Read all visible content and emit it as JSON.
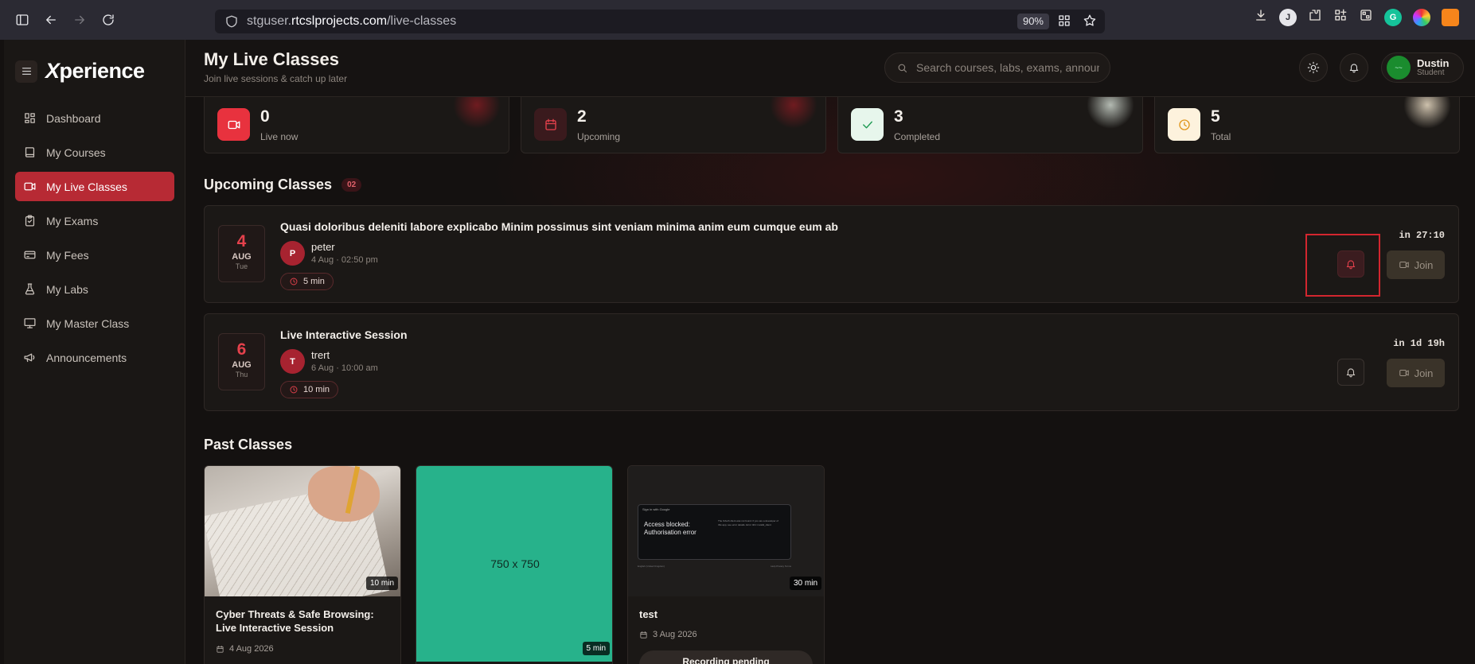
{
  "browser": {
    "url_host": "stguser.",
    "url_domain": "rtcslprojects.com",
    "url_path": "/live-classes",
    "zoom": "90%",
    "ext_j_label": "J"
  },
  "sidebar": {
    "logo_x": "X",
    "logo_rest": "perience",
    "items": [
      {
        "label": "Dashboard",
        "icon": "dashboard-icon"
      },
      {
        "label": "My Courses",
        "icon": "book-icon"
      },
      {
        "label": "My Live Classes",
        "icon": "video-icon"
      },
      {
        "label": "My Exams",
        "icon": "clipboard-icon"
      },
      {
        "label": "My Fees",
        "icon": "card-icon"
      },
      {
        "label": "My Labs",
        "icon": "flask-icon"
      },
      {
        "label": "My Master Class",
        "icon": "presentation-icon"
      },
      {
        "label": "Announcements",
        "icon": "megaphone-icon"
      }
    ],
    "active_index": 2
  },
  "header": {
    "title": "My Live Classes",
    "subtitle": "Join live sessions & catch up later",
    "search_placeholder": "Search courses, labs, exams, announcements...",
    "user_name": "Dustin",
    "user_role": "Student",
    "avatar_text": "~~"
  },
  "stats": [
    {
      "value": "0",
      "label": "Live now",
      "color": "#e8323e"
    },
    {
      "value": "2",
      "label": "Upcoming",
      "color": "#c93a45"
    },
    {
      "value": "3",
      "label": "Completed",
      "color": "#1e9a52"
    },
    {
      "value": "5",
      "label": "Total",
      "color": "#e0961b"
    }
  ],
  "upcoming": {
    "title": "Upcoming Classes",
    "badge": "02",
    "classes": [
      {
        "day": "4",
        "month": "AUG",
        "weekday": "Tue",
        "title": "Quasi doloribus deleniti labore explicabo Minim possimus sint veniam minima anim eum cumque eum ab",
        "instructor_initial": "P",
        "instructor": "peter",
        "when": "4 Aug · 02:50 pm",
        "duration": "5 min",
        "countdown": "in 27:10",
        "join_label": "Join",
        "reminder_active": true
      },
      {
        "day": "6",
        "month": "AUG",
        "weekday": "Thu",
        "title": "Live Interactive Session",
        "instructor_initial": "T",
        "instructor": "trert",
        "when": "6 Aug · 10:00 am",
        "duration": "10 min",
        "countdown": "in 1d 19h",
        "join_label": "Join",
        "reminder_active": false
      }
    ]
  },
  "past": {
    "title": "Past Classes",
    "classes": [
      {
        "title": "Cyber Threats & Safe Browsing: Live Interactive Session",
        "date": "4 Aug 2026",
        "duration": "10 min"
      },
      {
        "placeholder": "750 x 750",
        "duration": "5 min"
      },
      {
        "title": "test",
        "date": "3 Aug 2026",
        "duration": "30 min",
        "button": "Recording pending",
        "mini_top": "Sign in with Google",
        "mini_title": "Access blocked: Authorisation error",
        "mini_text": "The OAuth client was not found. If you are a developer of this app, see error details. Error 401: invalid_client",
        "mini_footer_left": "English (United Kingdom)",
        "mini_footer_right": "Help   Privacy   Terms"
      }
    ]
  }
}
